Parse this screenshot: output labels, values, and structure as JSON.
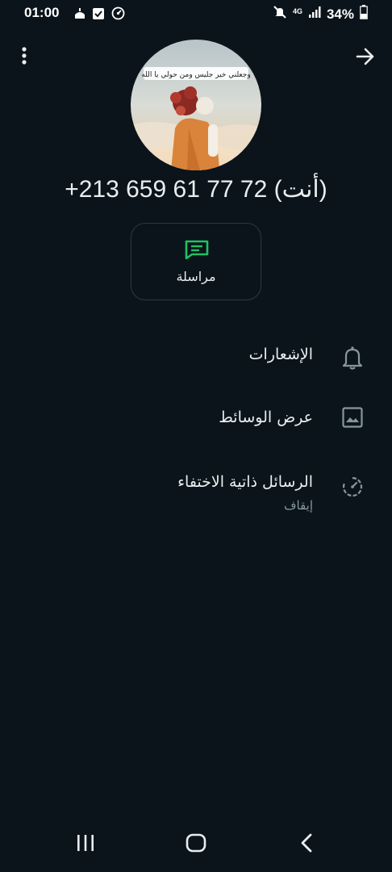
{
  "status_bar": {
    "time": "01:00",
    "network": "4G",
    "battery": "34%"
  },
  "header": {
    "menu_icon": "more-vert-icon",
    "forward_icon": "arrow-forward-icon"
  },
  "profile": {
    "name": "+213 659 61 77 72 (أنت)",
    "avatar_caption": "وجعلني خير جليس ومن حولي يا الله"
  },
  "actions": {
    "message_label": "مراسلة",
    "message_icon": "message-icon"
  },
  "settings": {
    "notifications_label": "الإشعارات",
    "media_label": "عرض الوسائط",
    "disappearing_label": "الرسائل ذاتية الاختفاء",
    "disappearing_value": "إيقاف"
  },
  "colors": {
    "background": "#0b141b",
    "accent": "#21c063",
    "text_primary": "#e9edef",
    "text_secondary": "#8696a0"
  }
}
